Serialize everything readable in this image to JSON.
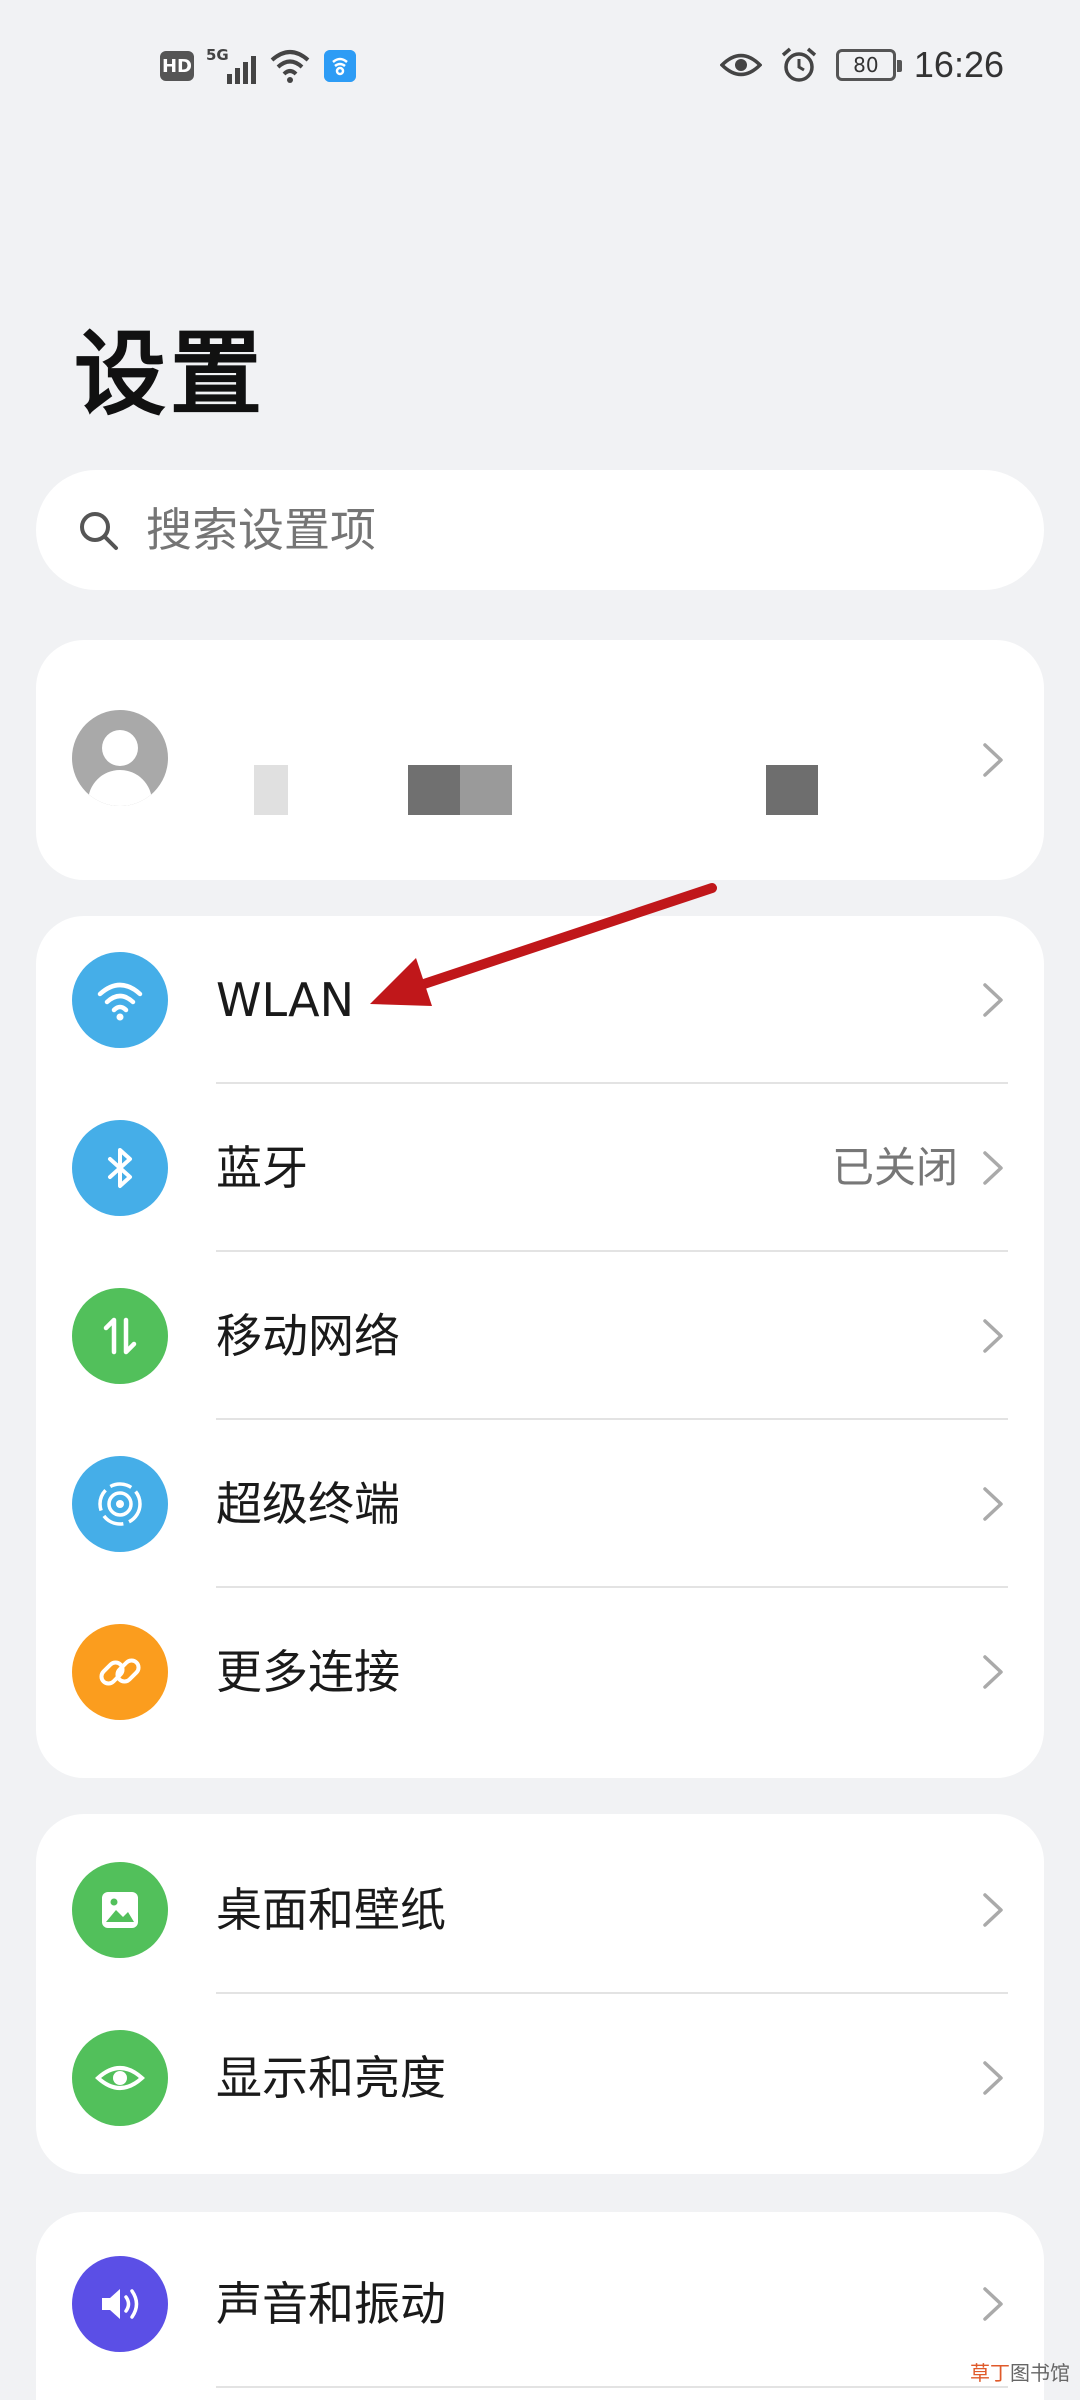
{
  "status_bar": {
    "hd": "HD",
    "network": "5G",
    "battery": "80",
    "time": "16:26",
    "icons": [
      "hd-icon",
      "5g-signal-icon",
      "wifi-icon",
      "sync-icon",
      "eye-icon",
      "alarm-icon",
      "battery-icon"
    ]
  },
  "header": {
    "title": "设置"
  },
  "search": {
    "placeholder": "搜索设置项",
    "icon": "search-icon"
  },
  "profile": {
    "avatar_icon": "avatar-icon"
  },
  "groups": [
    {
      "items": [
        {
          "label": "WLAN",
          "icon": "wifi-icon",
          "color": "#45aee8",
          "status": ""
        },
        {
          "label": "蓝牙",
          "icon": "bluetooth-icon",
          "color": "#45aee8",
          "status": "已关闭"
        },
        {
          "label": "移动网络",
          "icon": "mobile-data-icon",
          "color": "#52c05b",
          "status": ""
        },
        {
          "label": "超级终端",
          "icon": "super-device-icon",
          "color": "#45aee8",
          "status": ""
        },
        {
          "label": "更多连接",
          "icon": "link-icon",
          "color": "#fb9d1e",
          "status": ""
        }
      ]
    },
    {
      "items": [
        {
          "label": "桌面和壁纸",
          "icon": "wallpaper-icon",
          "color": "#52c05b",
          "status": ""
        },
        {
          "label": "显示和亮度",
          "icon": "eye-icon",
          "color": "#52c05b",
          "status": ""
        }
      ]
    },
    {
      "items": [
        {
          "label": "声音和振动",
          "icon": "speaker-icon",
          "color": "#5b4fe6",
          "status": ""
        }
      ]
    }
  ],
  "annotation": {
    "color": "#c0171a"
  },
  "watermark": {
    "part1": "草丁",
    "part2": "图书馆"
  }
}
